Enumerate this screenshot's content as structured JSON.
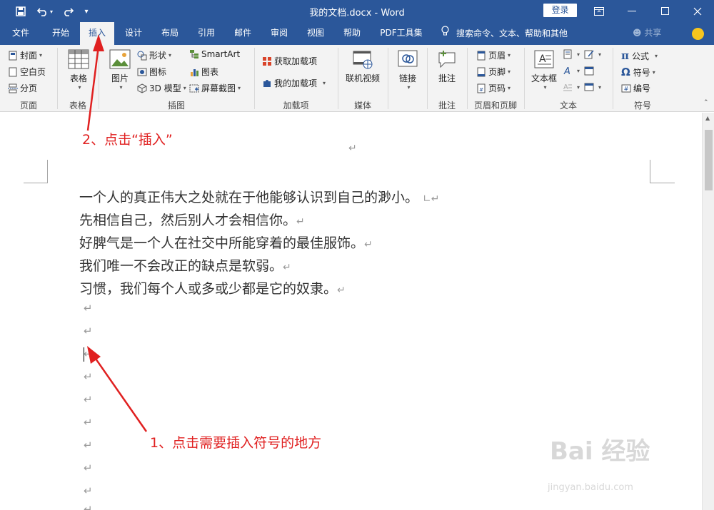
{
  "window": {
    "title": "我的文档.docx  -  Word",
    "login_label": "登录",
    "tell_me": "搜索命令、文本、帮助和其他",
    "share_label": "共享"
  },
  "tabs": [
    "文件",
    "开始",
    "插入",
    "设计",
    "布局",
    "引用",
    "邮件",
    "审阅",
    "视图",
    "帮助",
    "PDF工具集"
  ],
  "active_tab": "插入",
  "ribbon": {
    "pages": {
      "cover": "封面",
      "blank": "空白页",
      "break": "分页",
      "label": "页面"
    },
    "table": {
      "table": "表格",
      "label": "表格"
    },
    "illustrations": {
      "picture": "图片",
      "shapes": "形状",
      "icons": "图标",
      "model3d": "3D 模型",
      "smartart": "SmartArt",
      "chart": "图表",
      "screenshot": "屏幕截图",
      "label": "插图"
    },
    "addins": {
      "get": "获取加载项",
      "my": "我的加载项",
      "label": "加载项"
    },
    "media": {
      "video": "联机视频",
      "label": "媒体"
    },
    "links": {
      "link": "链接"
    },
    "comments": {
      "comment": "批注",
      "label": "批注"
    },
    "header_footer": {
      "header": "页眉",
      "footer": "页脚",
      "page_number": "页码",
      "label": "页眉和页脚"
    },
    "text": {
      "textbox": "文本框",
      "label": "文本"
    },
    "symbols": {
      "equation": "公式",
      "symbol": "符号",
      "number": "编号",
      "label": "符号"
    }
  },
  "document": {
    "paragraph_mark": "↵",
    "lines": [
      "一个人的真正伟大之处就在于他能够认识到自己的渺小。",
      "先相信自己，然后别人才会相信你。",
      "好脾气是一个人在社交中所能穿着的最佳服饰。",
      "我们唯一不会改正的缺点是软弱。",
      "习惯，我们每个人或多或少都是它的奴隶。"
    ]
  },
  "annotations": {
    "step2": "2、点击“插入”",
    "step1": "1、点击需要插入符号的地方",
    "color": "#e02020"
  },
  "watermark": {
    "main": "Bai 经验",
    "sub": "jingyan.baidu.com"
  },
  "colors": {
    "accent": "#2b579a",
    "ribbon_bg": "#f3f3f3"
  }
}
